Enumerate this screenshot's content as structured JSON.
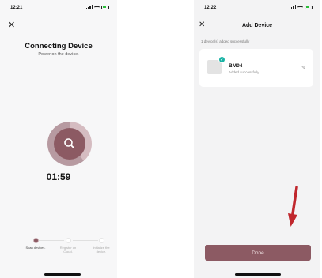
{
  "left_screen": {
    "status_time": "12:21",
    "title": "Connecting Device",
    "subtitle": "Power on the device.",
    "timer": "01:59",
    "steps": [
      {
        "label": "Scan devices.",
        "active": true
      },
      {
        "label": "Register on Cloud.",
        "active": false
      },
      {
        "label": "Initialize the device.",
        "active": false
      }
    ]
  },
  "right_screen": {
    "status_time": "12:22",
    "title": "Add Device",
    "added_count": "1 device(s) added successfully",
    "device": {
      "name": "BM04",
      "status": "Added successfully"
    },
    "done_label": "Done"
  },
  "icons": {
    "close": "close-icon",
    "search": "search-icon",
    "edit": "pencil-icon",
    "check": "check-icon",
    "arrow": "down-arrow-annotation"
  },
  "colors": {
    "accent": "#8c5a63",
    "accent_light": "#b79aa1",
    "check_badge": "#19b3a5",
    "arrow": "#c0272d",
    "battery": "#2bbd3a"
  }
}
